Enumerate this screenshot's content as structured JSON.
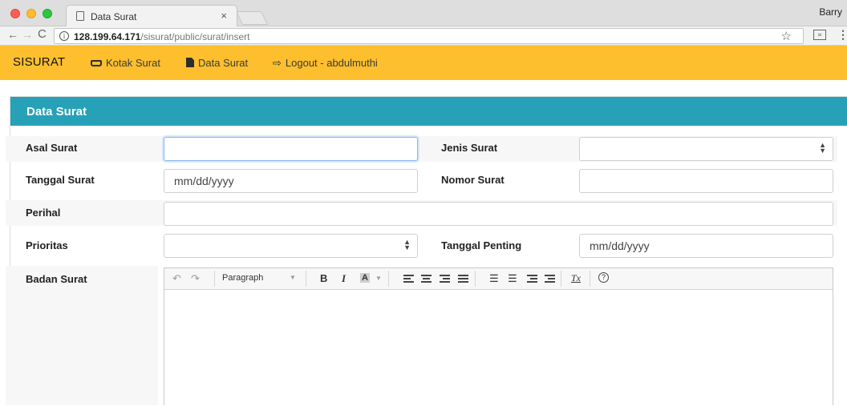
{
  "browser": {
    "tab_title": "Data Surat",
    "tab_close": "×",
    "user": "Barry",
    "url_host": "128.199.64.171",
    "url_path": "/sisurat/public/surat/insert",
    "info_glyph": "i",
    "back_glyph": "←",
    "forward_glyph": "→",
    "reload_glyph": "C",
    "star_glyph": "☆",
    "ext_glyph": "⌗",
    "menu_glyph": "⋮"
  },
  "navbar": {
    "brand": "SISURAT",
    "links": [
      {
        "label": "Kotak Surat",
        "icon": "inbox-icon"
      },
      {
        "label": "Data Surat",
        "icon": "file-icon"
      },
      {
        "label": "Logout - abdulmuthi",
        "icon": "sign-out-icon"
      }
    ],
    "logout_glyph": "⇨"
  },
  "panel": {
    "title": "Data Surat"
  },
  "form": {
    "asal_surat": {
      "label": "Asal Surat",
      "value": ""
    },
    "jenis_surat": {
      "label": "Jenis Surat",
      "value": ""
    },
    "tanggal_surat": {
      "label": "Tanggal Surat",
      "placeholder": "mm/dd/yyyy"
    },
    "nomor_surat": {
      "label": "Nomor Surat",
      "value": ""
    },
    "perihal": {
      "label": "Perihal",
      "value": ""
    },
    "prioritas": {
      "label": "Prioritas",
      "value": ""
    },
    "tanggal_penting": {
      "label": "Tanggal Penting",
      "placeholder": "mm/dd/yyyy"
    },
    "badan_surat": {
      "label": "Badan Surat"
    },
    "select_arrow_glyph": "▲\n▼"
  },
  "editor": {
    "undo_glyph": "↶",
    "redo_glyph": "↷",
    "format_label": "Paragraph",
    "format_arrow": "▼",
    "bold": "B",
    "italic": "I",
    "text_color": "A",
    "color_arrow": "▼",
    "bullet_list": "☰",
    "numbered_list": "☰",
    "clear_format": "Tx",
    "help": "?"
  },
  "colors": {
    "navbar": "#fdbf2d",
    "panel_header": "#27a1b7"
  }
}
